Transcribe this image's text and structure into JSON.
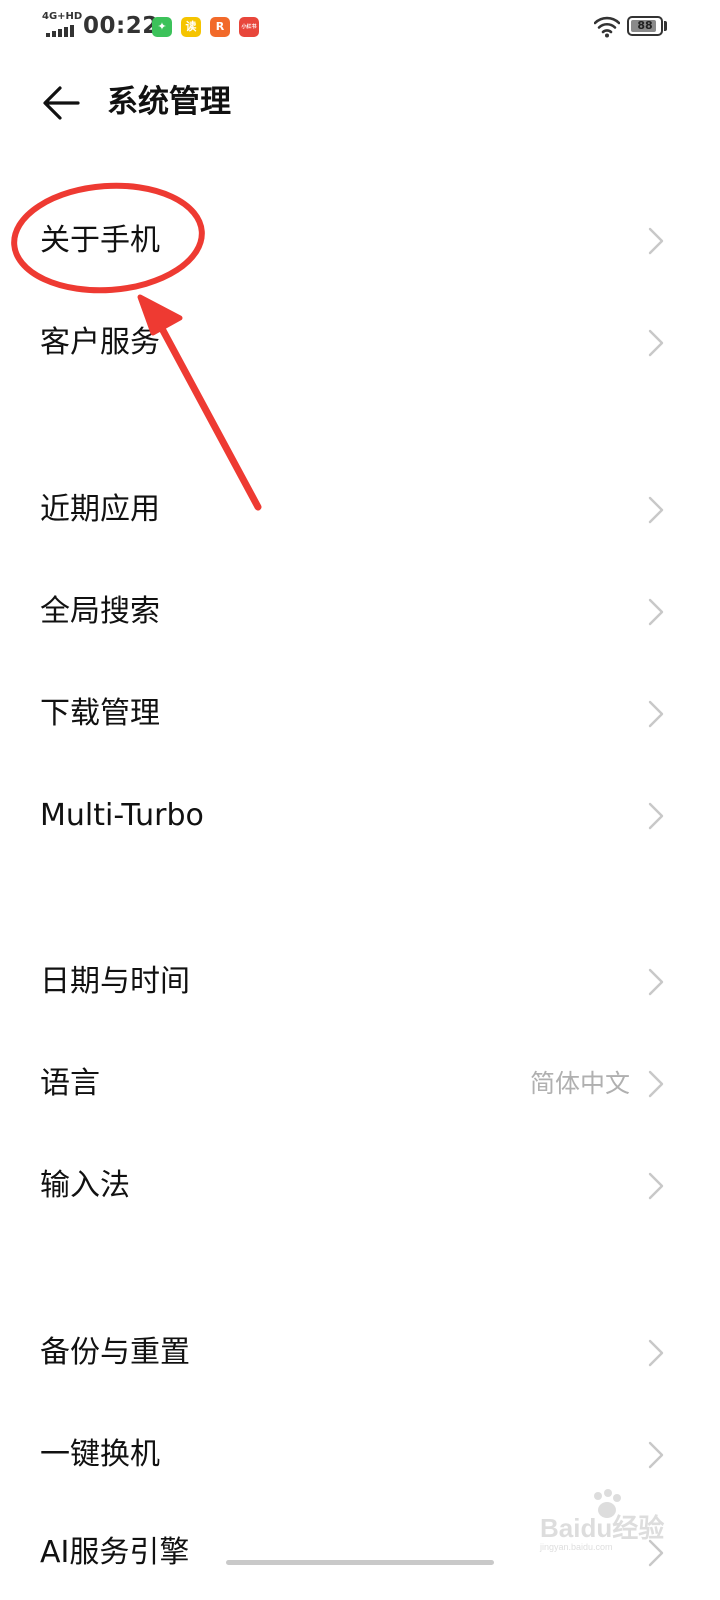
{
  "status_bar": {
    "network": "4G+HD",
    "time": "00:22",
    "battery": "88",
    "battery_level": 0.88,
    "notification_icons": [
      {
        "icon": "green-app-icon",
        "color": "#3cc25a",
        "glyph": "✦"
      },
      {
        "icon": "yellow-book-app-icon",
        "color": "#f5c400",
        "glyph": "读"
      },
      {
        "icon": "orange-app-icon",
        "color": "#f26a2a",
        "glyph": "R"
      },
      {
        "icon": "red-app-icon",
        "color": "#e8463b",
        "glyph": "小红书"
      }
    ]
  },
  "header": {
    "title": "系统管理",
    "back_icon": "arrow-left-icon"
  },
  "sections": [
    {
      "items": [
        {
          "id": "about-phone",
          "label": "关于手机"
        },
        {
          "id": "customer-service",
          "label": "客户服务"
        }
      ]
    },
    {
      "items": [
        {
          "id": "recent-apps",
          "label": "近期应用"
        },
        {
          "id": "global-search",
          "label": "全局搜索"
        },
        {
          "id": "download-management",
          "label": "下载管理"
        },
        {
          "id": "multi-turbo",
          "label": "Multi-Turbo"
        }
      ]
    },
    {
      "items": [
        {
          "id": "date-time",
          "label": "日期与时间"
        },
        {
          "id": "language",
          "label": "语言",
          "value": "简体中文"
        },
        {
          "id": "input-method",
          "label": "输入法"
        }
      ]
    },
    {
      "items": [
        {
          "id": "backup-reset",
          "label": "备份与重置"
        },
        {
          "id": "one-key-switch",
          "label": "一键换机"
        },
        {
          "id": "ai-service-engine",
          "label": "AI服务引擎"
        }
      ]
    }
  ],
  "watermark": {
    "text": "Baidu经验",
    "sub": "jingyan.baidu.com"
  },
  "colors": {
    "annotation_red": "#ee3a32",
    "chevron": "#c8c8c8",
    "value_text": "#b0b0b0"
  }
}
